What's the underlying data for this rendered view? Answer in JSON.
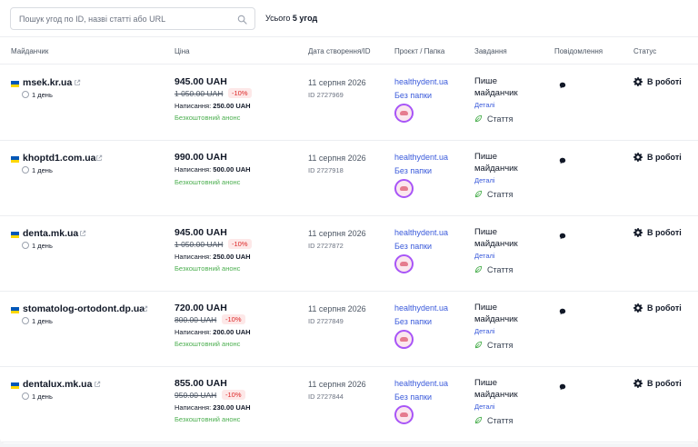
{
  "search": {
    "placeholder": "Пошук угод по ID, назві статті або URL"
  },
  "summary": {
    "label": "Усього",
    "count": "5 угод"
  },
  "columns": [
    "Майданчик",
    "Ціна",
    "Дата створення/ID",
    "Проєкт / Папка",
    "Завдання",
    "Повідомлення",
    "Статус"
  ],
  "colors": {
    "link": "#3b5bdb",
    "discount": "#dc2626",
    "free": "#4caf50",
    "flag_blue": "#0057b7",
    "flag_yellow": "#ffd700"
  },
  "rows": [
    {
      "domain": "msek.kr.ua",
      "days": "1 день",
      "price": "945.00 UAH",
      "old_price": "1 050.00 UAH",
      "discount": "-10%",
      "writing_label": "Написання:",
      "writing_value": "250.00 UAH",
      "anons": "Безкоштовний анонс",
      "date": "11 серпня 2026",
      "id": "ID 2727969",
      "project": "healthydent.ua",
      "folder": "Без папки",
      "task": "Пише майданчик",
      "details": "Деталі",
      "type": "Стаття",
      "status": "В роботі"
    },
    {
      "domain": "khoptd1.com.ua",
      "days": "1 день",
      "price": "990.00 UAH",
      "old_price": "",
      "discount": "",
      "writing_label": "Написання:",
      "writing_value": "500.00 UAH",
      "anons": "Безкоштовний анонс",
      "date": "11 серпня 2026",
      "id": "ID 2727918",
      "project": "healthydent.ua",
      "folder": "Без папки",
      "task": "Пише майданчик",
      "details": "Деталі",
      "type": "Стаття",
      "status": "В роботі"
    },
    {
      "domain": "denta.mk.ua",
      "days": "1 день",
      "price": "945.00 UAH",
      "old_price": "1 050.00 UAH",
      "discount": "-10%",
      "writing_label": "Написання:",
      "writing_value": "250.00 UAH",
      "anons": "Безкоштовний анонс",
      "date": "11 серпня 2026",
      "id": "ID 2727872",
      "project": "healthydent.ua",
      "folder": "Без папки",
      "task": "Пише майданчик",
      "details": "Деталі",
      "type": "Стаття",
      "status": "В роботі"
    },
    {
      "domain": "stomatolog-ortodont.dp.ua",
      "days": "1 день",
      "price": "720.00 UAH",
      "old_price": "800.00 UAH",
      "discount": "-10%",
      "writing_label": "Написання:",
      "writing_value": "200.00 UAH",
      "anons": "Безкоштовний анонс",
      "date": "11 серпня 2026",
      "id": "ID 2727849",
      "project": "healthydent.ua",
      "folder": "Без папки",
      "task": "Пише майданчик",
      "details": "Деталі",
      "type": "Стаття",
      "status": "В роботі"
    },
    {
      "domain": "dentalux.mk.ua",
      "days": "1 день",
      "price": "855.00 UAH",
      "old_price": "950.00 UAH",
      "discount": "-10%",
      "writing_label": "Написання:",
      "writing_value": "230.00 UAH",
      "anons": "Безкоштовний анонс",
      "date": "11 серпня 2026",
      "id": "ID 2727844",
      "project": "healthydent.ua",
      "folder": "Без папки",
      "task": "Пише майданчик",
      "details": "Деталі",
      "type": "Стаття",
      "status": "В роботі"
    }
  ]
}
